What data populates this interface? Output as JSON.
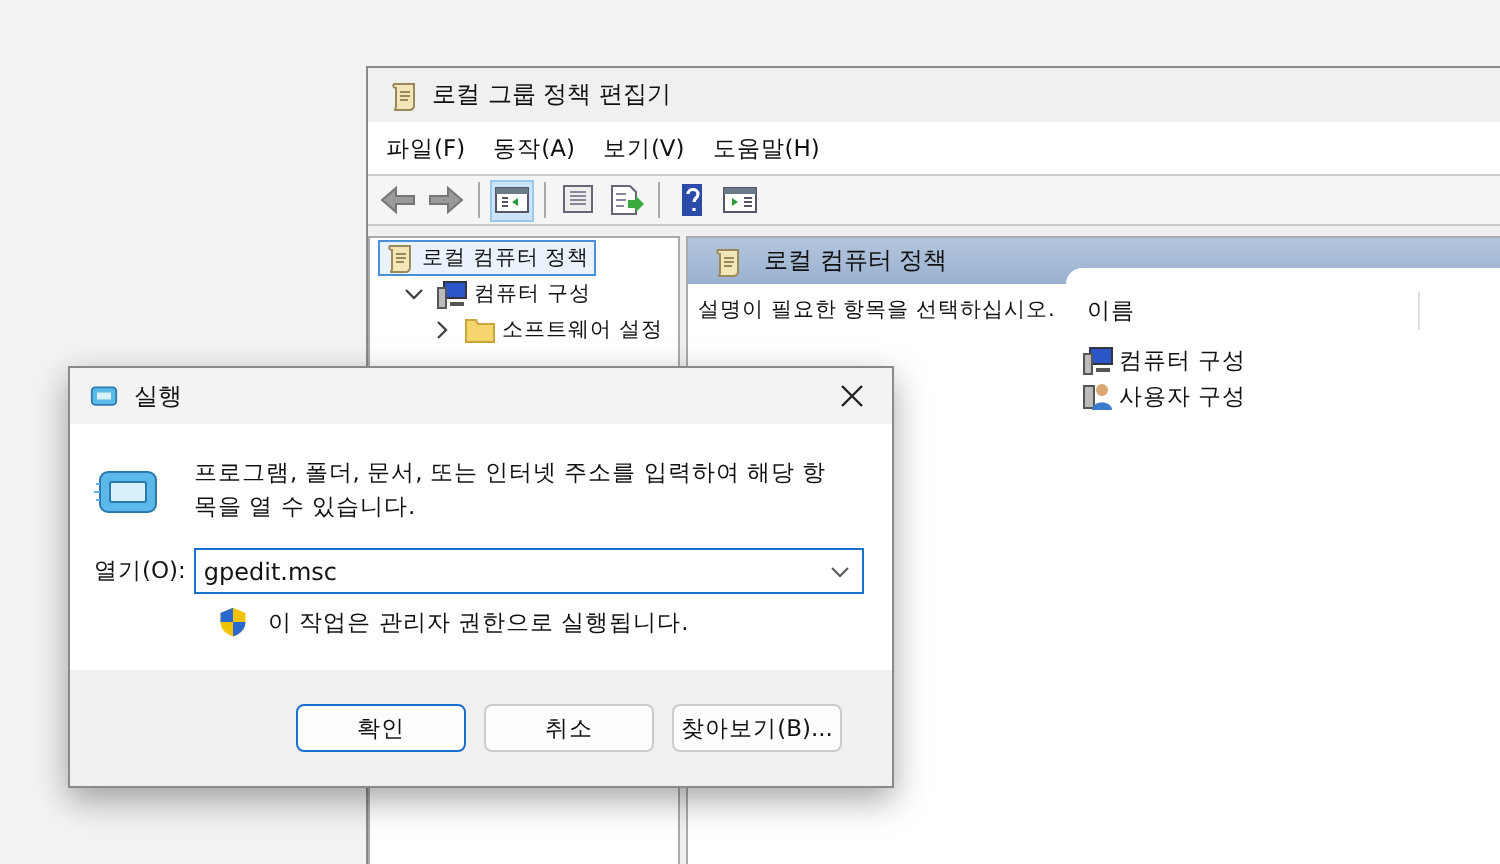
{
  "editor": {
    "title": "로컬 그룹 정책 편집기",
    "menu": [
      "파일(F)",
      "동작(A)",
      "보기(V)",
      "도움말(H)"
    ],
    "toolbar": [
      {
        "kind": "back",
        "disabled": false,
        "selected": false
      },
      {
        "kind": "forward",
        "disabled": false,
        "selected": false
      },
      {
        "kind": "separator"
      },
      {
        "kind": "tree",
        "disabled": false,
        "selected": true
      },
      {
        "kind": "separator"
      },
      {
        "kind": "properties",
        "disabled": false,
        "selected": false
      },
      {
        "kind": "export",
        "disabled": false,
        "selected": false
      },
      {
        "kind": "separator"
      },
      {
        "kind": "help",
        "disabled": false,
        "selected": false
      },
      {
        "kind": "console",
        "disabled": false,
        "selected": false
      }
    ],
    "tree": [
      {
        "label": "로컬 컴퓨터 정책",
        "kind": "policy",
        "selected": true,
        "children": [
          {
            "label": "컴퓨터 구성",
            "kind": "computer",
            "selected": false,
            "expanded": true,
            "children": [
              {
                "label": "소프트웨어 설정",
                "kind": "folder",
                "selected": false,
                "expanded": false
              }
            ]
          }
        ]
      }
    ],
    "details": {
      "header": "로컬 컴퓨터 정책",
      "description": "설명이 필요한 항목을 선택하십시오.",
      "column": "이름",
      "items": [
        {
          "label": "컴퓨터 구성",
          "kind": "computer"
        },
        {
          "label": "사용자 구성",
          "kind": "user"
        }
      ]
    }
  },
  "dialog": {
    "title": "실행",
    "message": "프로그램, 폴더, 문서, 또는 인터넷 주소를 입력하여 해당 항목을 열 수 있습니다.",
    "open_label": "열기(O):",
    "value": "gpedit.msc",
    "admin_note": "이 작업은 관리자 권한으로 실행됩니다.",
    "buttons": [
      {
        "label": "확인",
        "default": true
      },
      {
        "label": "취소",
        "default": false
      },
      {
        "label": "찾아보기(B)...",
        "default": false
      }
    ]
  }
}
